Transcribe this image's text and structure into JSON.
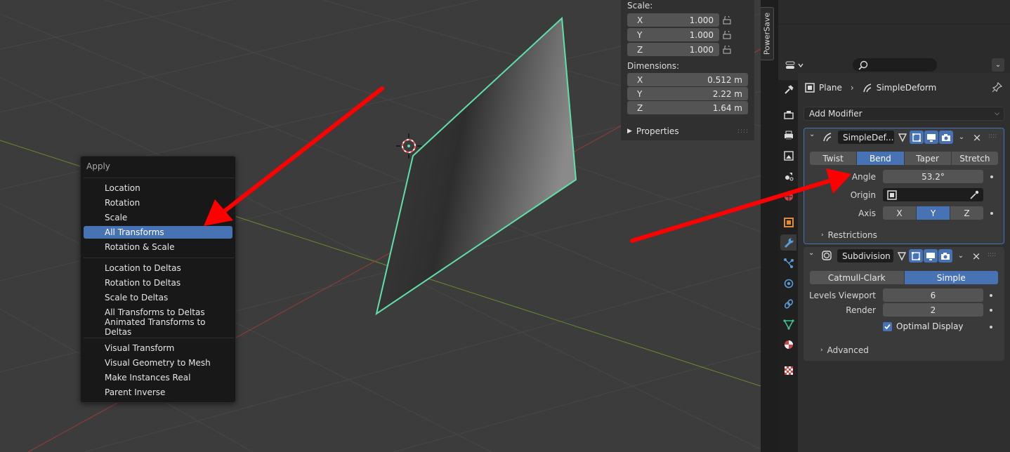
{
  "viewport": {
    "npanel": {
      "scale_label": "Scale:",
      "scale": [
        {
          "axis": "X",
          "value": "1.000"
        },
        {
          "axis": "Y",
          "value": "1.000"
        },
        {
          "axis": "Z",
          "value": "1.000"
        }
      ],
      "dimensions_label": "Dimensions:",
      "dimensions": [
        {
          "axis": "X",
          "value": "0.512 m"
        },
        {
          "axis": "Y",
          "value": "2.22 m"
        },
        {
          "axis": "Z",
          "value": "1.64 m"
        }
      ],
      "properties_label": "Properties"
    },
    "powersave_tab": "PowerSave"
  },
  "apply_menu": {
    "title": "Apply",
    "groups": [
      [
        "Location",
        "Rotation",
        "Scale",
        "All Transforms",
        "Rotation & Scale"
      ],
      [
        "Location to Deltas",
        "Rotation to Deltas",
        "Scale to Deltas",
        "All Transforms to Deltas",
        "Animated Transforms to Deltas"
      ],
      [
        "Visual Transform",
        "Visual Geometry to Mesh",
        "Make Instances Real",
        "Parent Inverse"
      ]
    ],
    "highlighted": "All Transforms"
  },
  "properties": {
    "breadcrumb": {
      "object": "Plane",
      "modifier": "SimpleDeform"
    },
    "add_modifier": "Add Modifier",
    "simple_deform": {
      "name": "SimpleDef...",
      "modes": [
        "Twist",
        "Bend",
        "Taper",
        "Stretch"
      ],
      "active_mode": "Bend",
      "angle_label": "Angle",
      "angle_value": "53.2°",
      "origin_label": "Origin",
      "axis_label": "Axis",
      "axes": [
        "X",
        "Y",
        "Z"
      ],
      "active_axis": "Y",
      "restrictions_label": "Restrictions"
    },
    "subdivision": {
      "name": "Subdivision",
      "modes": [
        "Catmull-Clark",
        "Simple"
      ],
      "active_mode": "Simple",
      "levels_viewport_label": "Levels Viewport",
      "levels_viewport_value": "6",
      "render_label": "Render",
      "render_value": "2",
      "optimal_display_label": "Optimal Display",
      "optimal_display_checked": true,
      "advanced_label": "Advanced"
    }
  },
  "colors": {
    "accent": "#4772b3",
    "selection_outline": "#5fe0a8",
    "annotation_arrow": "#ff0000"
  }
}
